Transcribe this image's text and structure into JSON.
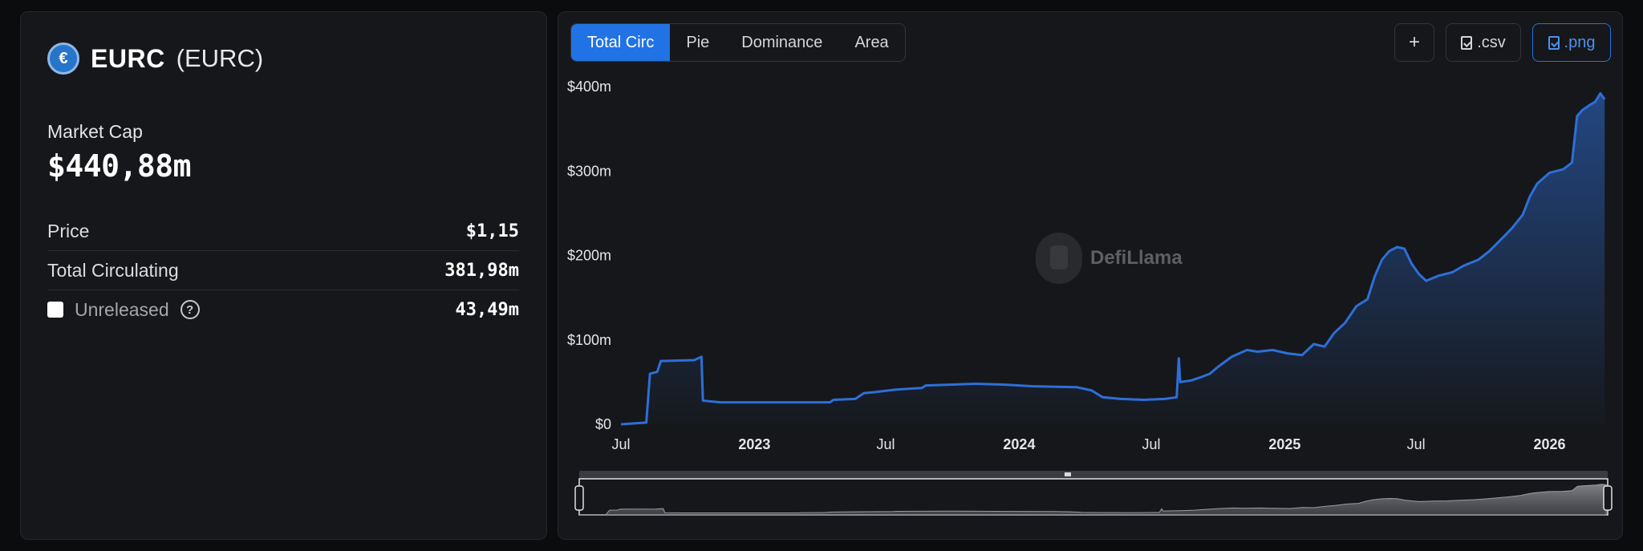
{
  "coin": {
    "logo_glyph": "€",
    "name": "EURC",
    "symbol": "(EURC)"
  },
  "market_cap": {
    "label": "Market Cap",
    "value": "$440,88m"
  },
  "stats": {
    "price_label": "Price",
    "price_value": "$1,15",
    "circ_label": "Total Circulating",
    "circ_value": "381,98m",
    "unreleased_label": "Unreleased",
    "unreleased_value": "43,49m",
    "help_glyph": "?"
  },
  "tabs": [
    "Total Circ",
    "Pie",
    "Dominance",
    "Area"
  ],
  "active_tab": "Total Circ",
  "toolbar": {
    "add_label": "+",
    "csv_label": ".csv",
    "png_label": ".png"
  },
  "watermark": "DefiLlama",
  "colors": {
    "accent": "#2172e5",
    "line": "#2d6fd8",
    "background": "#16171a"
  },
  "chart_data": {
    "type": "area",
    "title": "",
    "xlabel": "",
    "ylabel": "",
    "ylim": [
      0,
      400
    ],
    "y_unit": "m USD",
    "y_ticks": [
      "$0",
      "$100m",
      "$200m",
      "$300m",
      "$400m"
    ],
    "x_ticks": [
      {
        "label": "Jul",
        "bold": false,
        "x": "2022-07-01"
      },
      {
        "label": "2023",
        "bold": true,
        "x": "2023-01-01"
      },
      {
        "label": "Jul",
        "bold": false,
        "x": "2023-07-01"
      },
      {
        "label": "2024",
        "bold": true,
        "x": "2024-01-01"
      },
      {
        "label": "Jul",
        "bold": false,
        "x": "2024-07-01"
      },
      {
        "label": "2025",
        "bold": true,
        "x": "2025-01-01"
      },
      {
        "label": "Jul",
        "bold": false,
        "x": "2025-07-01"
      },
      {
        "label": "2026",
        "bold": true,
        "x": "2026-01-01"
      }
    ],
    "x_range": [
      "2022-07-01",
      "2026-03-20"
    ],
    "series": [
      {
        "values": [
          [
            "2022-07-01",
            0
          ],
          [
            "2022-08-05",
            2
          ],
          [
            "2022-08-10",
            60
          ],
          [
            "2022-08-20",
            62
          ],
          [
            "2022-08-25",
            75
          ],
          [
            "2022-10-10",
            76
          ],
          [
            "2022-10-20",
            80
          ],
          [
            "2022-10-22",
            28
          ],
          [
            "2022-11-15",
            26
          ],
          [
            "2023-04-15",
            26
          ],
          [
            "2023-04-20",
            29
          ],
          [
            "2023-05-20",
            30
          ],
          [
            "2023-06-01",
            37
          ],
          [
            "2023-06-15",
            38
          ],
          [
            "2023-07-15",
            41
          ],
          [
            "2023-08-20",
            43
          ],
          [
            "2023-08-25",
            46
          ],
          [
            "2023-10-01",
            47
          ],
          [
            "2023-11-01",
            48
          ],
          [
            "2023-12-10",
            47
          ],
          [
            "2024-01-20",
            45
          ],
          [
            "2024-03-20",
            44
          ],
          [
            "2024-04-10",
            40
          ],
          [
            "2024-04-25",
            32
          ],
          [
            "2024-05-20",
            30
          ],
          [
            "2024-06-20",
            29
          ],
          [
            "2024-07-20",
            30
          ],
          [
            "2024-08-05",
            32
          ],
          [
            "2024-08-08",
            78
          ],
          [
            "2024-08-10",
            50
          ],
          [
            "2024-08-25",
            52
          ],
          [
            "2024-09-05",
            55
          ],
          [
            "2024-09-20",
            60
          ],
          [
            "2024-10-01",
            68
          ],
          [
            "2024-10-20",
            80
          ],
          [
            "2024-11-10",
            88
          ],
          [
            "2024-11-25",
            86
          ],
          [
            "2024-12-15",
            88
          ],
          [
            "2025-01-05",
            84
          ],
          [
            "2025-01-25",
            82
          ],
          [
            "2025-02-10",
            95
          ],
          [
            "2025-02-25",
            92
          ],
          [
            "2025-03-10",
            108
          ],
          [
            "2025-03-25",
            120
          ],
          [
            "2025-04-10",
            140
          ],
          [
            "2025-04-25",
            148
          ],
          [
            "2025-05-05",
            175
          ],
          [
            "2025-05-15",
            195
          ],
          [
            "2025-05-25",
            205
          ],
          [
            "2025-06-05",
            210
          ],
          [
            "2025-06-15",
            208
          ],
          [
            "2025-06-25",
            190
          ],
          [
            "2025-07-05",
            178
          ],
          [
            "2025-07-15",
            170
          ],
          [
            "2025-08-01",
            176
          ],
          [
            "2025-08-20",
            180
          ],
          [
            "2025-09-05",
            188
          ],
          [
            "2025-09-25",
            195
          ],
          [
            "2025-10-10",
            205
          ],
          [
            "2025-10-25",
            218
          ],
          [
            "2025-11-10",
            232
          ],
          [
            "2025-11-25",
            248
          ],
          [
            "2025-12-05",
            270
          ],
          [
            "2025-12-15",
            285
          ],
          [
            "2026-01-01",
            298
          ],
          [
            "2026-01-20",
            302
          ],
          [
            "2026-02-01",
            310
          ],
          [
            "2026-02-08",
            365
          ],
          [
            "2026-02-15",
            372
          ],
          [
            "2026-02-25",
            378
          ],
          [
            "2026-03-05",
            382
          ],
          [
            "2026-03-12",
            392
          ],
          [
            "2026-03-18",
            385
          ]
        ]
      }
    ],
    "grid": false,
    "legend": "none"
  }
}
